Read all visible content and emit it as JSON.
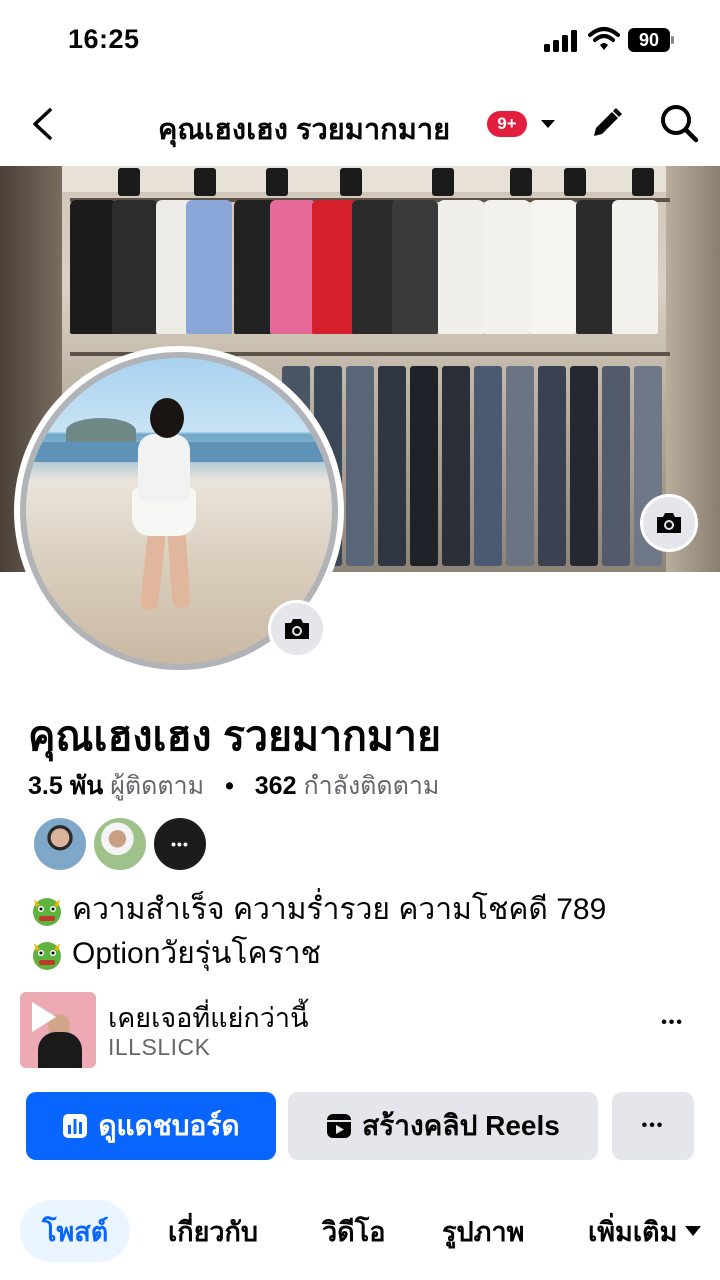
{
  "status_bar": {
    "time": "16:25",
    "battery": "90",
    "icons": [
      "signal-icon",
      "wifi-icon",
      "battery-icon"
    ]
  },
  "header": {
    "title": "คุณเฮงเฮง รวยมากมาย",
    "notification_badge": "9+",
    "icons": [
      "back-icon",
      "chevron-down-icon",
      "pencil-icon",
      "search-icon"
    ]
  },
  "profile": {
    "name": "คุณเฮงเฮง รวยมากมาย",
    "followers_count": "3.5 พัน",
    "followers_label": "ผู้ติดตาม",
    "separator": "•",
    "following_count": "362",
    "following_label": "กำลังติดตาม",
    "friends_more": "•••",
    "bio": [
      "ความสำเร็จ ความร่ำรวย ความโชคดี 789",
      "Optionวัยรุ่นโคราช"
    ]
  },
  "music": {
    "title": "เคยเจอที่แย่กว่านี้",
    "artist": "ILLSLICK",
    "more": "•••"
  },
  "actions": {
    "dashboard": "ดูแดชบอร์ด",
    "create_reels": "สร้างคลิป Reels",
    "more": "•••"
  },
  "tabs": [
    "โพสต์",
    "เกี่ยวกับ",
    "วิดีโอ",
    "รูปภาพ",
    "เพิ่มเติม"
  ],
  "colors": {
    "accent": "#0866ff",
    "badge": "#e41e3f",
    "secondary_button": "#e4e6eb",
    "muted_text": "#65676b"
  }
}
